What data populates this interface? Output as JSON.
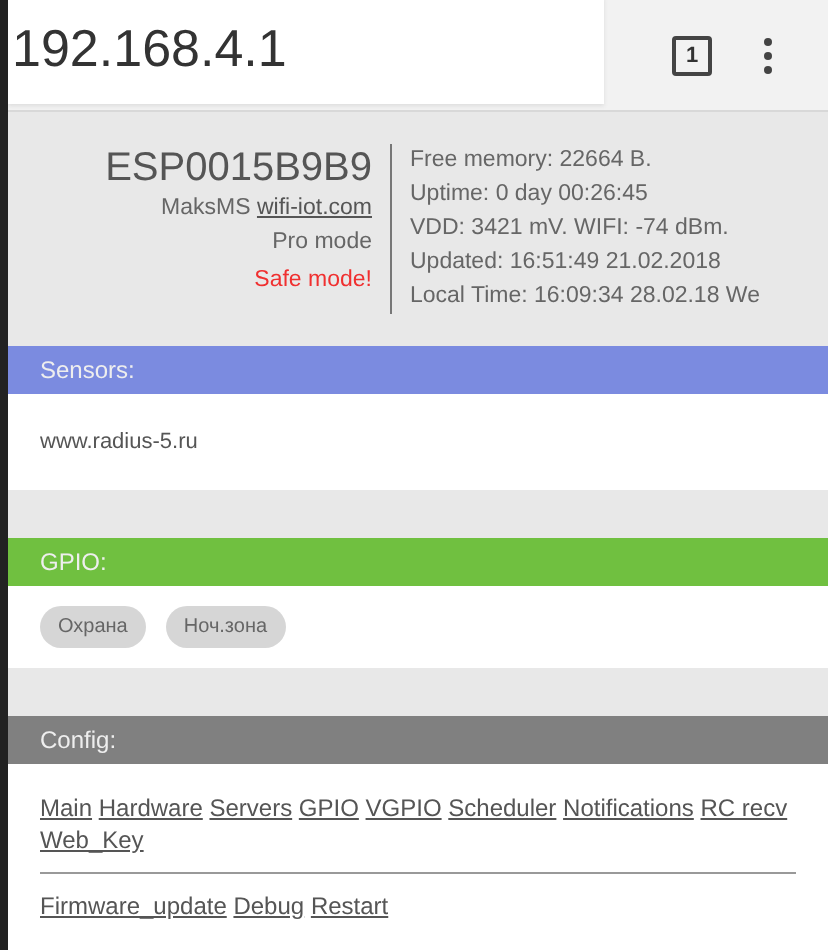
{
  "address_bar": {
    "url": "192.168.4.1",
    "tab_count": "1"
  },
  "device": {
    "name": "ESP0015B9B9",
    "author": "MaksMS",
    "site": "wifi-iot.com",
    "mode": "Pro mode",
    "warning": "Safe mode!"
  },
  "stats": [
    "Free memory: 22664 B.",
    "Uptime: 0 day 00:26:45",
    "VDD: 3421 mV. WIFI: -74 dBm.",
    "Updated: 16:51:49 21.02.2018",
    "Local Time: 16:09:34 28.02.18 We"
  ],
  "sections": [
    {
      "kind": "sensors",
      "title": "Sensors:",
      "color": "#7b8be0",
      "text": "www.radius-5.ru"
    },
    {
      "kind": "gpio",
      "title": "GPIO:",
      "color": "#70c040",
      "buttons": [
        {
          "label": "Охрана",
          "disabled": true
        },
        {
          "label": "Ноч.зона",
          "disabled": true
        }
      ]
    },
    {
      "kind": "config",
      "title": "Config:",
      "color": "#808080",
      "links": [
        "Main",
        "Hardware",
        "Servers",
        "GPIO",
        "VGPIO",
        "Scheduler",
        "Notifications",
        "RC recv",
        "Web_Key"
      ],
      "links_2": [
        "Firmware_update",
        "Debug",
        "Restart"
      ]
    }
  ]
}
